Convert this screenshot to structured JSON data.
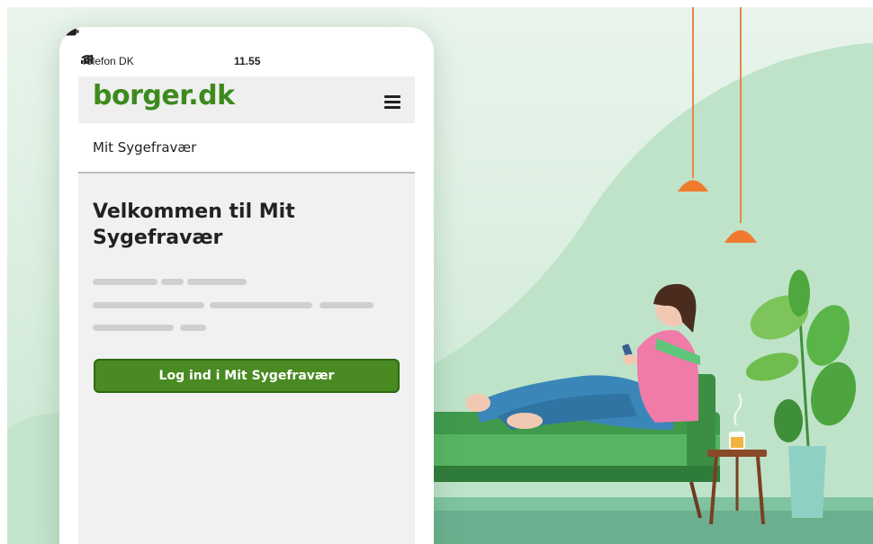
{
  "status_bar": {
    "carrier": "Telefon DK",
    "time": "11.55"
  },
  "header": {
    "logo": "borger.dk",
    "menu_icon": "hamburger-menu-icon"
  },
  "breadcrumb": {
    "label": "Mit Sygefravær"
  },
  "main": {
    "heading": "Velkommen til Mit Sygefravær",
    "login_button": "Log ind i Mit Sygefravær"
  },
  "colors": {
    "brand_green": "#3d8a1e",
    "button_green": "#4a8a23",
    "background_mint": "#dcefe1",
    "lamp_orange": "#f07a2e"
  },
  "illustration": {
    "elements": [
      "woman-on-sofa",
      "pendant-lamp",
      "pendant-lamp",
      "side-table",
      "teacup",
      "potted-plant"
    ]
  }
}
